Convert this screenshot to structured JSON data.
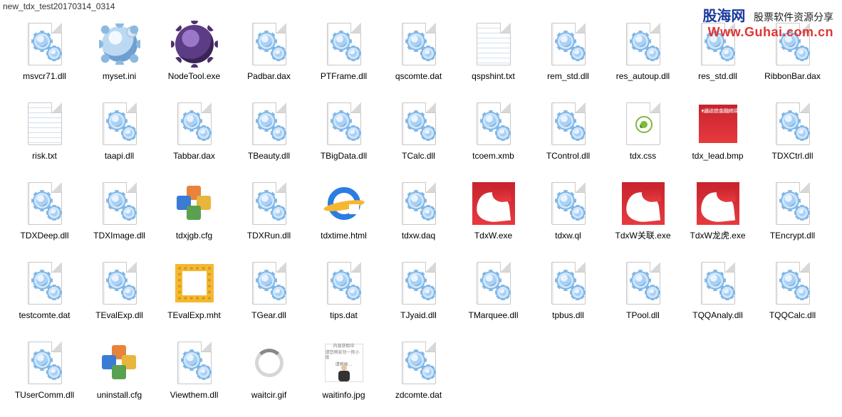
{
  "path": "new_tdx_test20170314_0314",
  "watermark": {
    "line1a": "股海网",
    "line1b": "股票软件资源分享",
    "line2": "Www.Guhai.com.cn"
  },
  "files": [
    {
      "name": "msvcr71.dll",
      "icon": "dll"
    },
    {
      "name": "myset.ini",
      "icon": "ini"
    },
    {
      "name": "NodeTool.exe",
      "icon": "darkgear"
    },
    {
      "name": "Padbar.dax",
      "icon": "dll"
    },
    {
      "name": "PTFrame.dll",
      "icon": "dll"
    },
    {
      "name": "qscomte.dat",
      "icon": "dll"
    },
    {
      "name": "qspshint.txt",
      "icon": "txt"
    },
    {
      "name": "rem_std.dll",
      "icon": "dll"
    },
    {
      "name": "res_autoup.dll",
      "icon": "dll"
    },
    {
      "name": "res_std.dll",
      "icon": "dll"
    },
    {
      "name": "RibbonBar.dax",
      "icon": "dll"
    },
    {
      "name": "risk.txt",
      "icon": "txt"
    },
    {
      "name": "taapi.dll",
      "icon": "dll"
    },
    {
      "name": "Tabbar.dax",
      "icon": "dll"
    },
    {
      "name": "TBeauty.dll",
      "icon": "dll"
    },
    {
      "name": "TBigData.dll",
      "icon": "dll"
    },
    {
      "name": "TCalc.dll",
      "icon": "dll"
    },
    {
      "name": "tcoem.xmb",
      "icon": "dll"
    },
    {
      "name": "TControl.dll",
      "icon": "dll"
    },
    {
      "name": "tdx.css",
      "icon": "css"
    },
    {
      "name": "tdx_lead.bmp",
      "icon": "redbmp"
    },
    {
      "name": "TDXCtrl.dll",
      "icon": "dll"
    },
    {
      "name": "TDXDeep.dll",
      "icon": "dll"
    },
    {
      "name": "TDXImage.dll",
      "icon": "dll"
    },
    {
      "name": "tdxjgb.cfg",
      "icon": "cfg"
    },
    {
      "name": "TDXRun.dll",
      "icon": "dll"
    },
    {
      "name": "tdxtime.html",
      "icon": "ie"
    },
    {
      "name": "tdxw.daq",
      "icon": "dll"
    },
    {
      "name": "TdxW.exe",
      "icon": "tdxw"
    },
    {
      "name": "tdxw.ql",
      "icon": "dll"
    },
    {
      "name": "TdxW关联.exe",
      "icon": "tdxw"
    },
    {
      "name": "TdxW龙虎.exe",
      "icon": "tdxw"
    },
    {
      "name": "TEncrypt.dll",
      "icon": "dll"
    },
    {
      "name": "testcomte.dat",
      "icon": "dll"
    },
    {
      "name": "TEvalExp.dll",
      "icon": "dll"
    },
    {
      "name": "TEvalExp.mht",
      "icon": "mht"
    },
    {
      "name": "TGear.dll",
      "icon": "dll"
    },
    {
      "name": "tips.dat",
      "icon": "dll"
    },
    {
      "name": "TJyaid.dll",
      "icon": "dll"
    },
    {
      "name": "TMarquee.dll",
      "icon": "dll"
    },
    {
      "name": "tpbus.dll",
      "icon": "dll"
    },
    {
      "name": "TPool.dll",
      "icon": "dll"
    },
    {
      "name": "TQQAnaly.dll",
      "icon": "dll"
    },
    {
      "name": "TQQCalc.dll",
      "icon": "dll"
    },
    {
      "name": "TUserComm.dll",
      "icon": "dll"
    },
    {
      "name": "uninstall.cfg",
      "icon": "cfg"
    },
    {
      "name": "Viewthem.dll",
      "icon": "dll"
    },
    {
      "name": "waitcir.gif",
      "icon": "wait"
    },
    {
      "name": "waitinfo.jpg",
      "icon": "waitinfo"
    },
    {
      "name": "zdcomte.dat",
      "icon": "dll"
    }
  ]
}
